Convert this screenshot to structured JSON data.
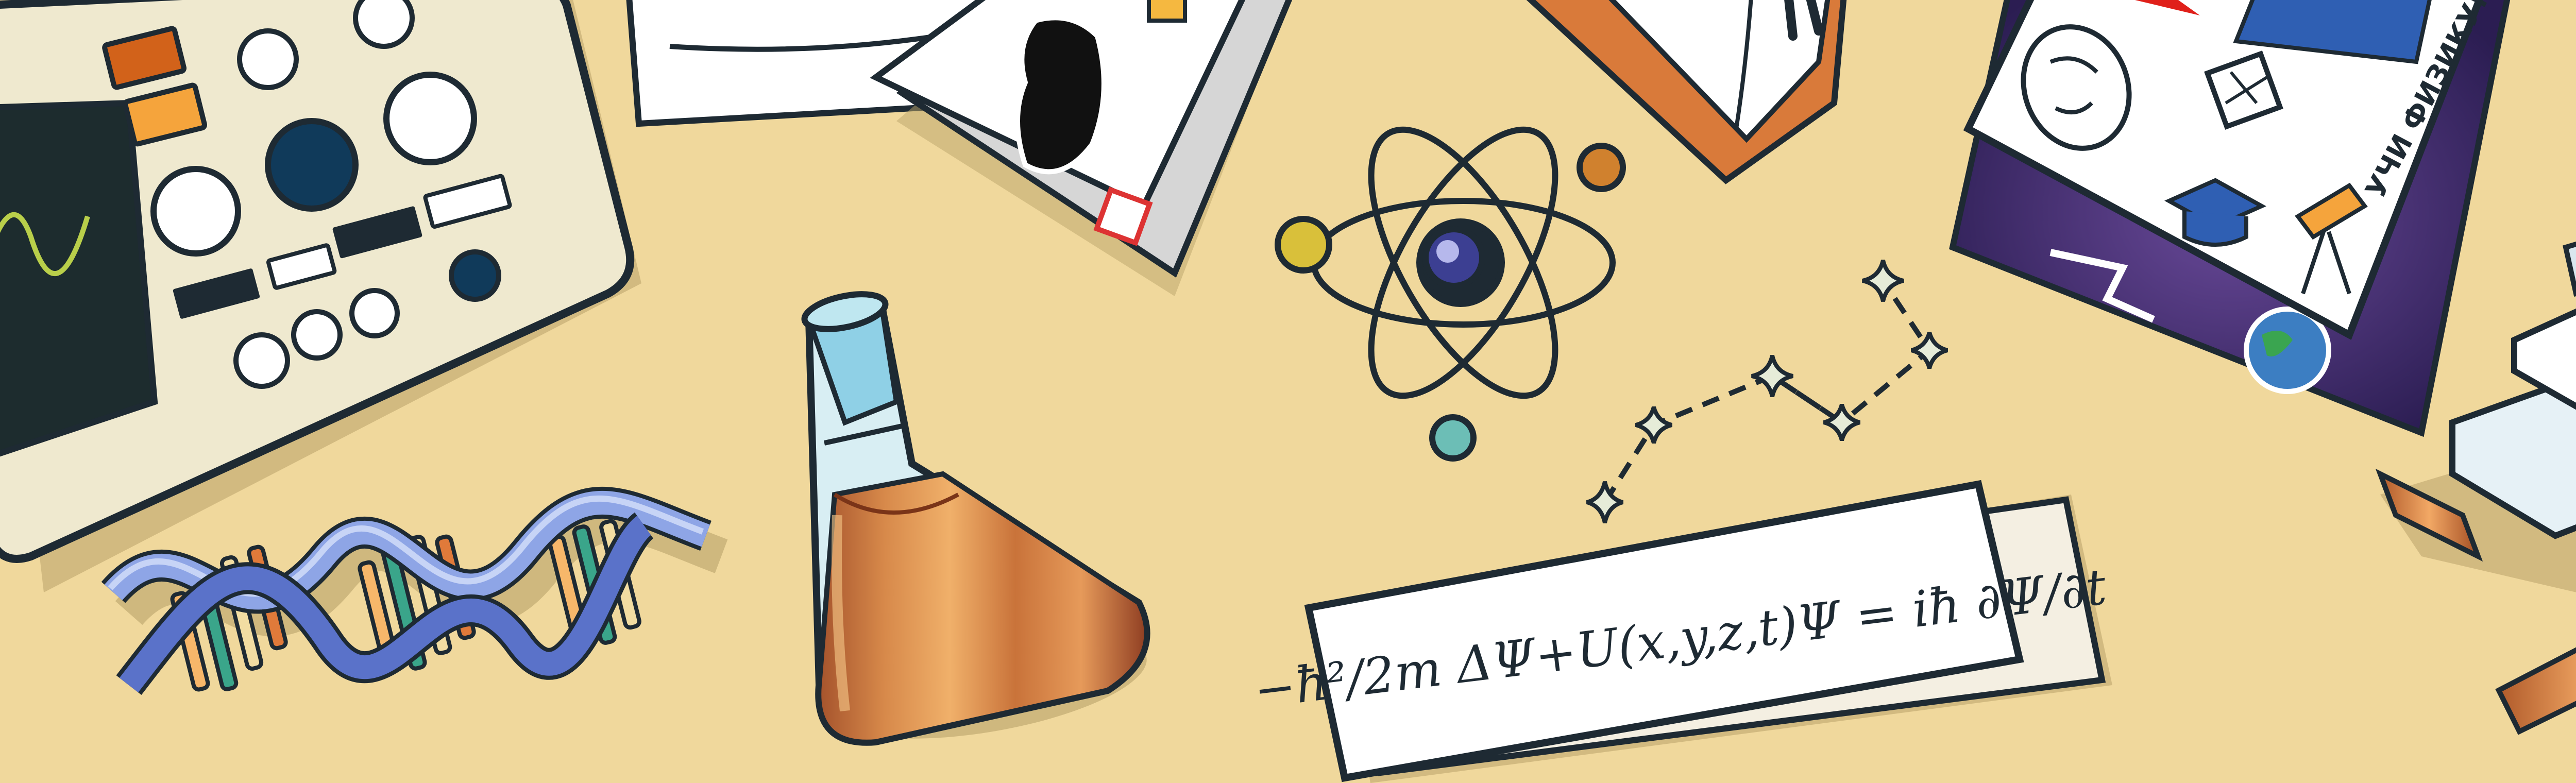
{
  "scene": {
    "description_label": "",
    "background_color": "#f0d89c",
    "outline_color": "#1e2a33"
  },
  "equation": {
    "text": "−ħ²/2m ΔΨ+U(x,y,z,t)Ψ = iħ ∂Ψ/∂t"
  },
  "sticker": {
    "text": "УЧИ ФИЗИКУ!"
  },
  "icons": [
    "oscilloscope-icon",
    "dna-helix-icon",
    "erlenmeyer-flask-icon",
    "atom-icon",
    "constellation-icon",
    "book-icon",
    "sticker-sheet-icon",
    "einstein-sticker-icon",
    "cube-sticker-icon",
    "graduation-cap-icon",
    "telescope-icon",
    "globe-icon",
    "microscope-icon"
  ]
}
